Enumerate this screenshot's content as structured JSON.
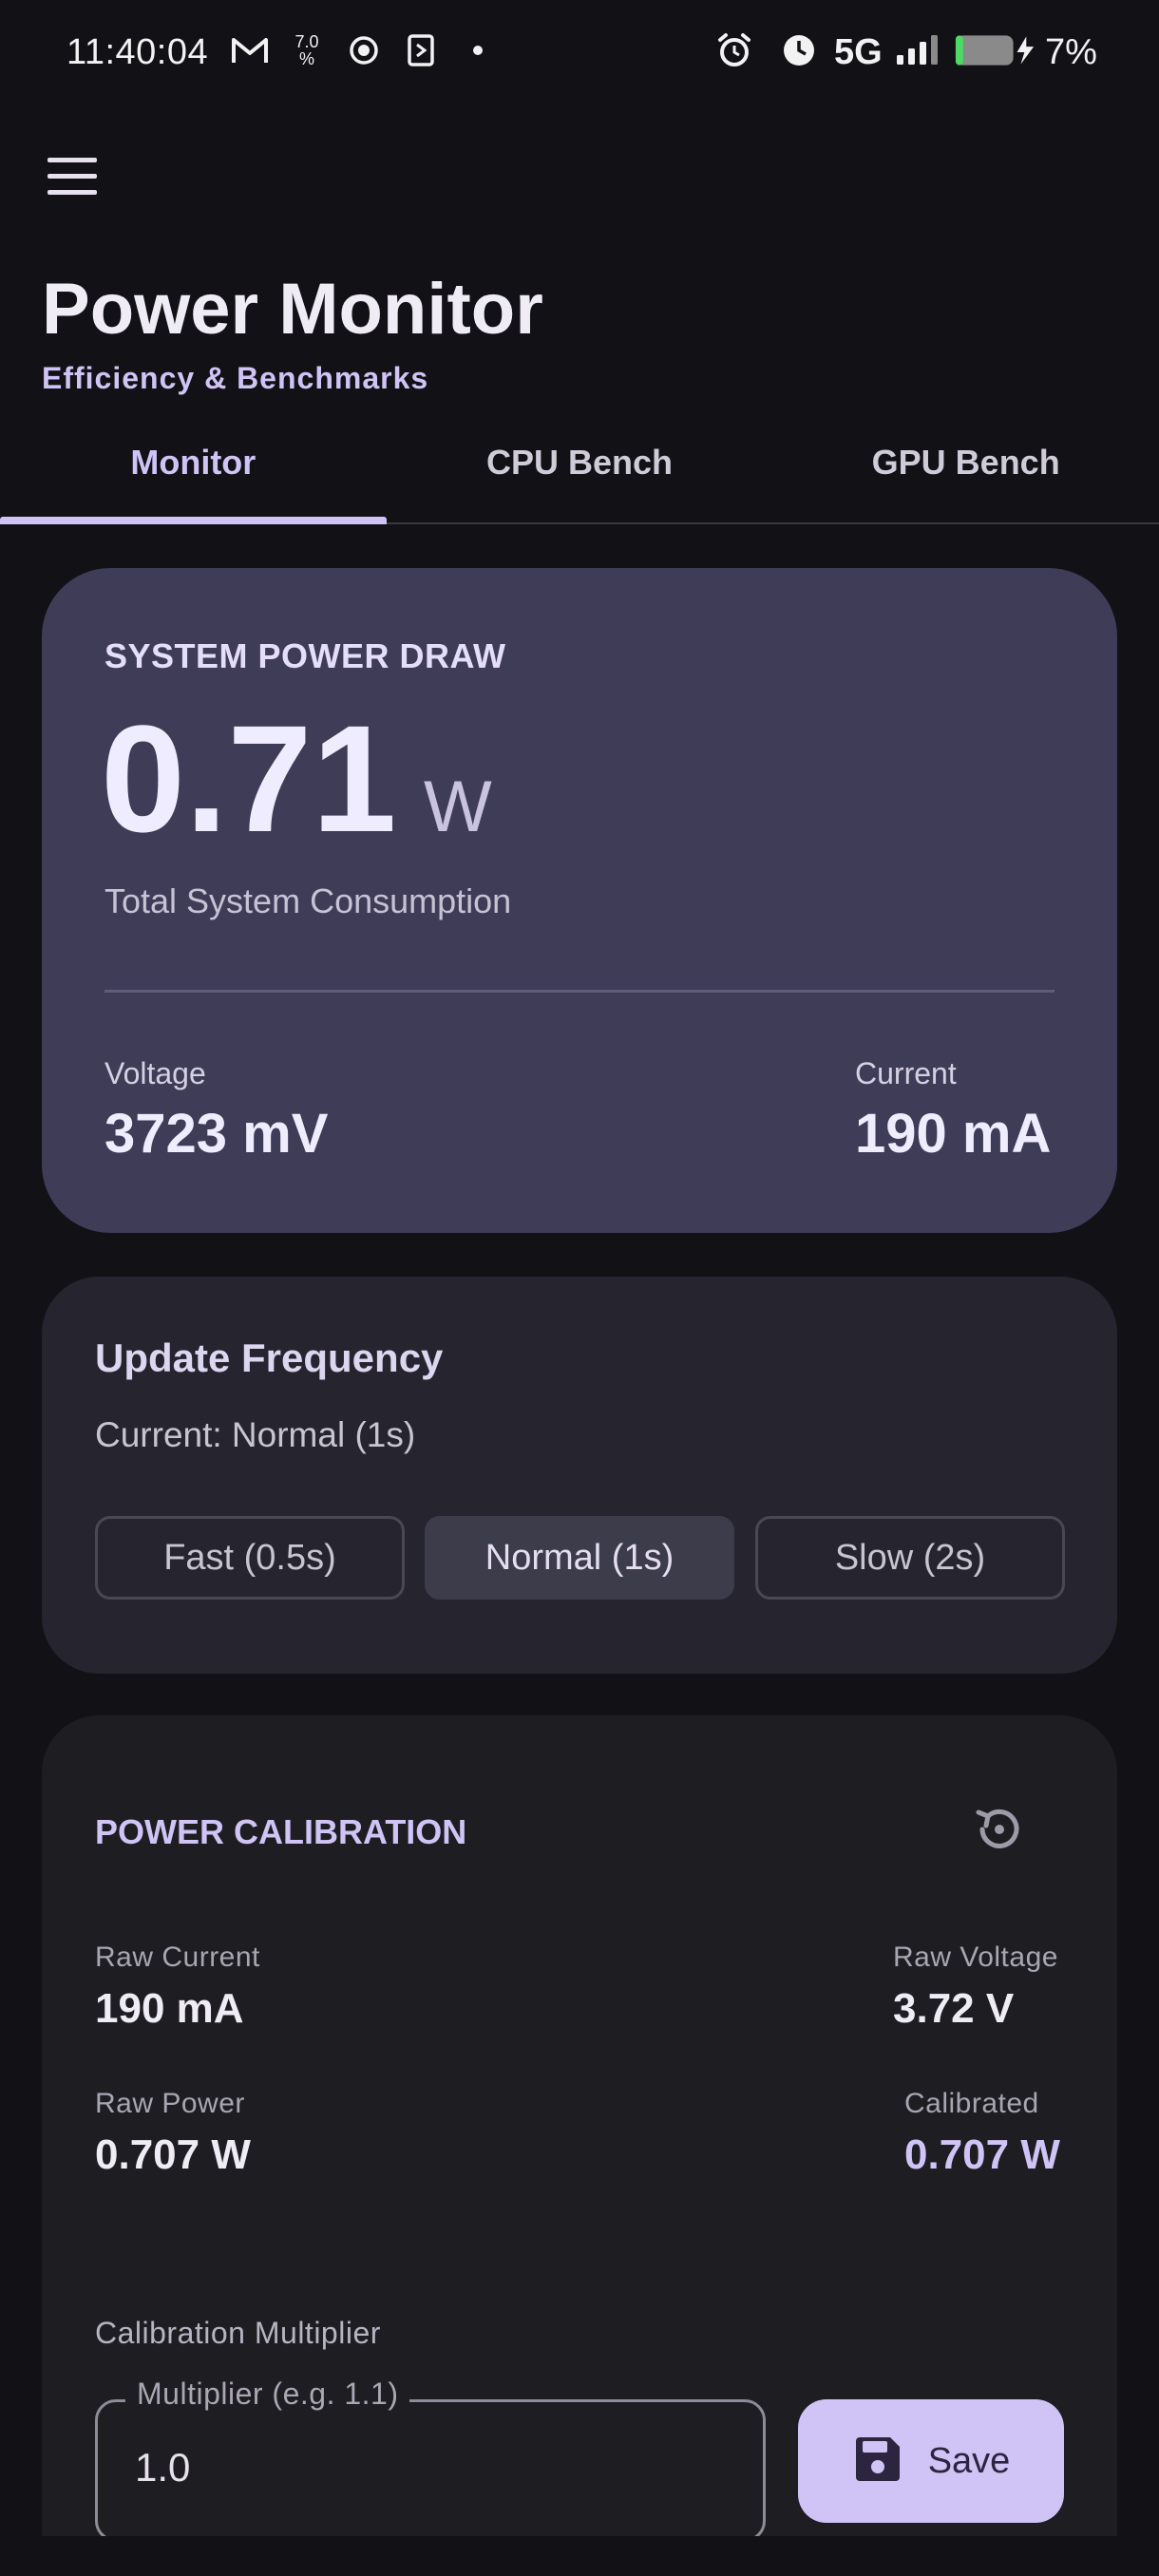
{
  "status_bar": {
    "time": "11:40:04",
    "data_rate": "7.0",
    "network": "5G",
    "battery_percent": "7%",
    "icons": [
      "gmail-icon",
      "data-rate-icon",
      "record-icon",
      "nfc-icon",
      "dot-icon",
      "alarm-icon",
      "clock-icon",
      "signal-icon",
      "battery-charging-icon"
    ]
  },
  "app": {
    "title": "Power Monitor",
    "subtitle": "Efficiency & Benchmarks"
  },
  "tabs": [
    {
      "label": "Monitor",
      "active": true
    },
    {
      "label": "CPU Bench",
      "active": false
    },
    {
      "label": "GPU Bench",
      "active": false
    }
  ],
  "power": {
    "label": "SYSTEM POWER DRAW",
    "value": "0.71",
    "unit": "W",
    "description": "Total System Consumption",
    "voltage_label": "Voltage",
    "voltage_value": "3723 mV",
    "current_label": "Current",
    "current_value": "190 mA"
  },
  "frequency": {
    "title": "Update Frequency",
    "current": "Current: Normal (1s)",
    "options": [
      {
        "label": "Fast (0.5s)",
        "selected": false
      },
      {
        "label": "Normal (1s)",
        "selected": true
      },
      {
        "label": "Slow (2s)",
        "selected": false
      }
    ]
  },
  "calibration": {
    "title": "POWER CALIBRATION",
    "raw_current_label": "Raw Current",
    "raw_current_value": "190 mA",
    "raw_voltage_label": "Raw Voltage",
    "raw_voltage_value": "3.72 V",
    "raw_power_label": "Raw Power",
    "raw_power_value": "0.707 W",
    "calibrated_label": "Calibrated",
    "calibrated_value": "0.707 W",
    "multiplier_label": "Calibration Multiplier",
    "multiplier_field_label": "Multiplier (e.g. 1.1)",
    "multiplier_value": "1.0",
    "save_label": "Save"
  },
  "colors": {
    "background": "#111116",
    "accent": "#cfc4f5",
    "power_card": "#3f3c58",
    "frequency_card": "#26252f",
    "calibration_card": "#1d1d22"
  }
}
